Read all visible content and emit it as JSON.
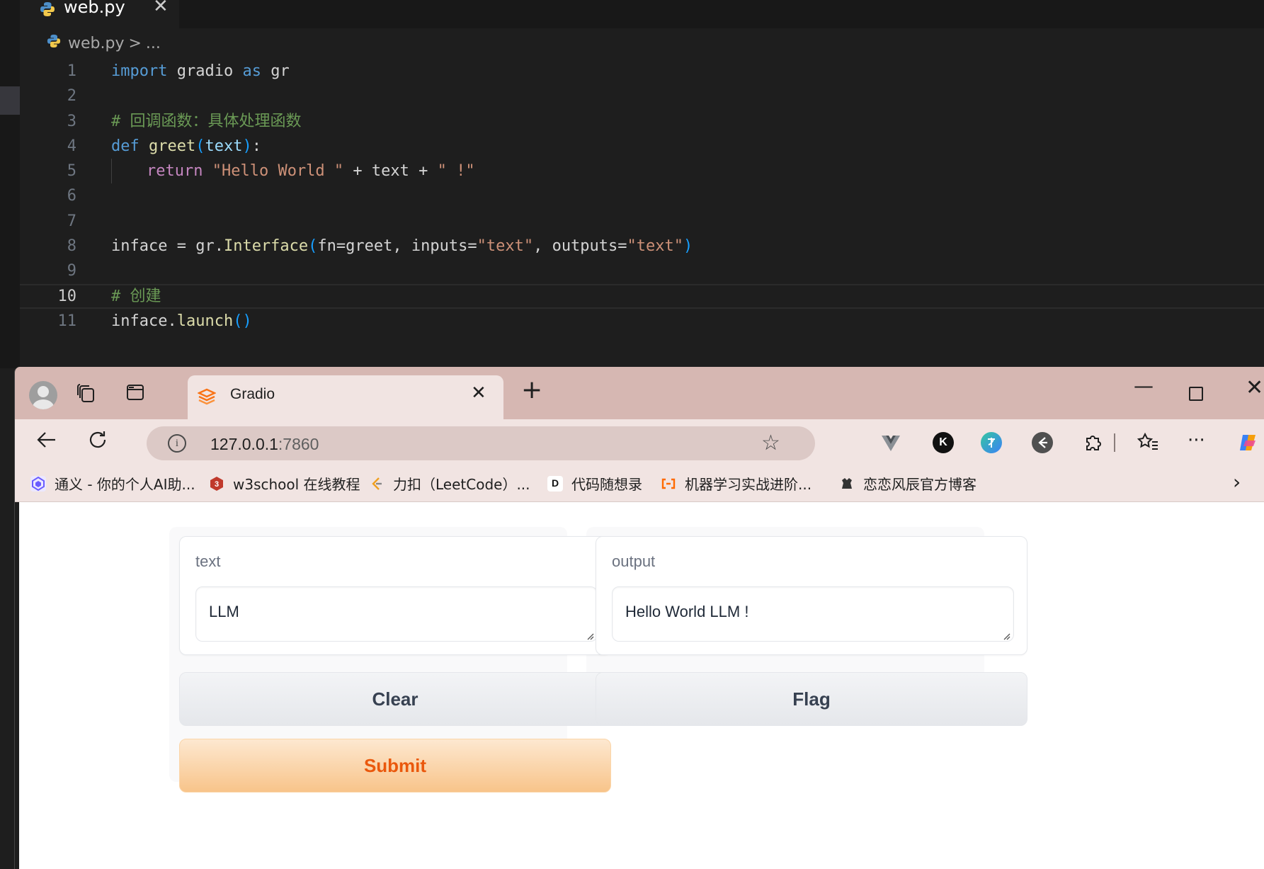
{
  "editor": {
    "tab": {
      "filename": "web.py",
      "close": "✕"
    },
    "breadcrumb": {
      "file": "web.py",
      "separator": ">",
      "more": "..."
    },
    "lines": [
      {
        "n": "1"
      },
      {
        "n": "2"
      },
      {
        "n": "3"
      },
      {
        "n": "4"
      },
      {
        "n": "5"
      },
      {
        "n": "6"
      },
      {
        "n": "7"
      },
      {
        "n": "8"
      },
      {
        "n": "9"
      },
      {
        "n": "10"
      },
      {
        "n": "11"
      }
    ],
    "code": {
      "l1": {
        "kw": "import",
        "mod": " gradio ",
        "as": "as",
        "alias": " gr"
      },
      "l3": "# 回调函数：具体处理函数",
      "l4": {
        "kw": "def",
        "sp": " ",
        "fn": "greet",
        "open": "(",
        "param": "text",
        "close": ")",
        "colon": ":"
      },
      "l5": {
        "kw": "return",
        "sp": " ",
        "s1": "\"Hello World \"",
        "mid": " + text + ",
        "s2": "\" !\""
      },
      "l8": {
        "a": "inface = gr.",
        "fn": "Interface",
        "open": "(",
        "b": "fn=greet, inputs=",
        "s1": "\"text\"",
        "c": ", outputs=",
        "s2": "\"text\"",
        "close": ")"
      },
      "l10": "# 创建",
      "l11": {
        "a": "inface.",
        "fn": "launch",
        "paren": "()"
      }
    }
  },
  "browser": {
    "tab_title": "Gradio",
    "url": {
      "host": "127.0.0.1",
      "port": ":7860"
    },
    "bookmarks": [
      {
        "label": "通义 - 你的个人AI助...",
        "color": "#6a5cff"
      },
      {
        "label": "w3school 在线教程",
        "color": "#c0392b"
      },
      {
        "label": "力扣（LeetCode）...",
        "color": "#f0a020"
      },
      {
        "label": "代码随想录",
        "color": "#111111"
      },
      {
        "label": "机器学习实战进阶...",
        "color": "#ff6a00"
      },
      {
        "label": "恋恋风辰官方博客",
        "color": "#333333"
      }
    ],
    "extensions": {
      "k": "K"
    }
  },
  "gradio": {
    "input_label": "text",
    "input_value": "LLM",
    "output_label": "output",
    "output_value": "Hello World LLM !",
    "clear": "Clear",
    "submit": "Submit",
    "flag": "Flag"
  },
  "colors": {
    "accent": "#ea580c",
    "titlebar": "#d6b7b2",
    "editor_bg": "#1e1e1e"
  }
}
